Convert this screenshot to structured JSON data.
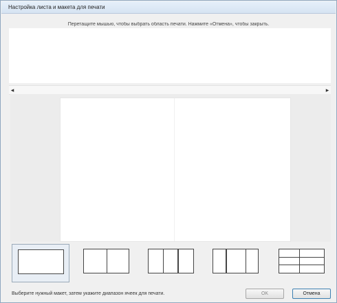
{
  "window": {
    "title": "Настройка листа и макета для печати"
  },
  "instruction": "Перетащите мышью, чтобы выбрать область печати. Нажмите «Отмена», чтобы закрыть.",
  "scrollbar": {
    "left_arrow": "◂",
    "right_arrow": "▸"
  },
  "layouts": [
    {
      "id": "single",
      "columns": 1,
      "rows": 1
    },
    {
      "id": "two-columns",
      "columns": 2,
      "rows": 1
    },
    {
      "id": "three-columns",
      "columns": 3,
      "rows": 1
    },
    {
      "id": "three-columns-alt",
      "columns": 3,
      "rows": 1
    },
    {
      "id": "two-by-three",
      "columns": 2,
      "rows": 3
    }
  ],
  "hint": "Выберите нужный макет, затем укажите диапазон ячеек для печати.",
  "buttons": {
    "ok_label": "OK",
    "cancel_label": "Отмена"
  }
}
